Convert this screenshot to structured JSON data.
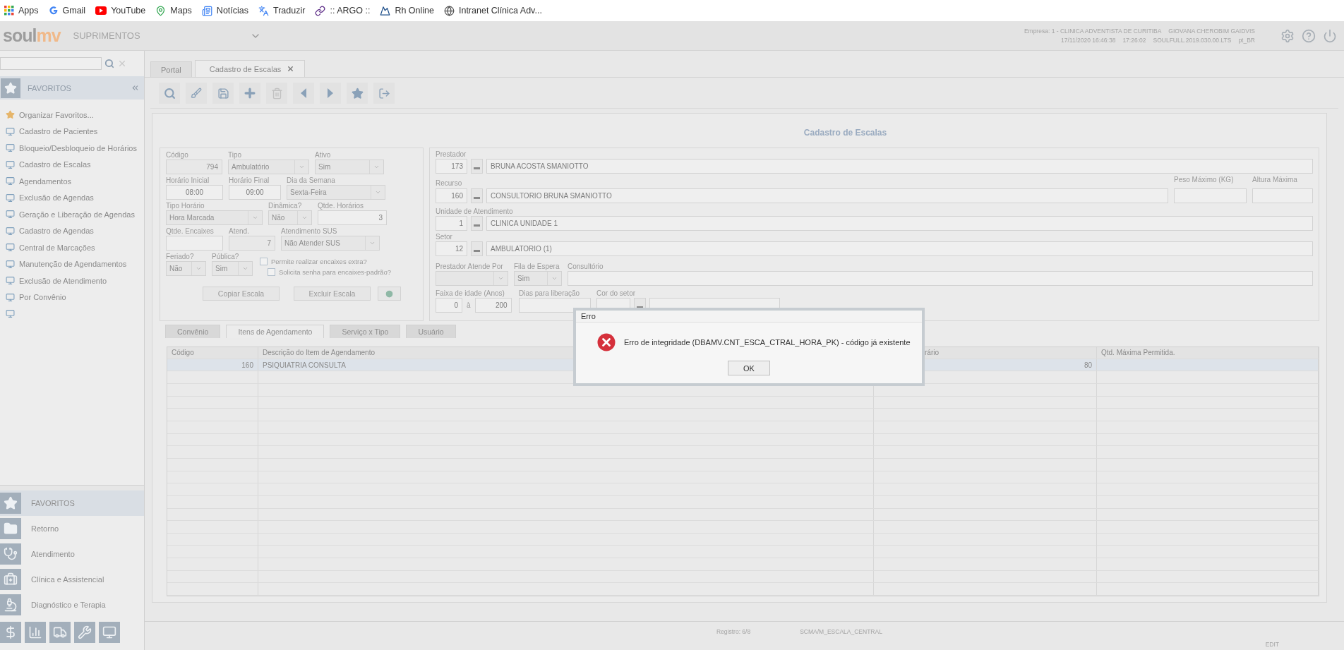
{
  "bookmarks": [
    {
      "label": "Apps",
      "kind": "apps"
    },
    {
      "label": "Gmail",
      "kind": "google"
    },
    {
      "label": "YouTube",
      "kind": "youtube"
    },
    {
      "label": "Maps",
      "kind": "maps"
    },
    {
      "label": "Notícias",
      "kind": "news"
    },
    {
      "label": "Traduzir",
      "kind": "translate"
    },
    {
      "label": ":: ARGO ::",
      "kind": "argo"
    },
    {
      "label": "Rh Online",
      "kind": "rh"
    },
    {
      "label": "Intranet Clínica Adv...",
      "kind": "globe"
    }
  ],
  "header": {
    "logo": {
      "part_1": "soul",
      "part_2": "mv"
    },
    "module": "SUPRIMENTOS",
    "company": "Empresa: 1 - CLINICA ADVENTISTA DE CURITIBA",
    "user": "GIOVANA CHEROBIM GAIDVIS",
    "login_time": "17/11/2020 16:46:38",
    "clock": "17:26:02",
    "version": "SOULFULL.2019.030.00.LTS",
    "locale": "pt_BR"
  },
  "sidebar": {
    "title": "FAVORITOS",
    "items": [
      {
        "label": "Organizar Favoritos...",
        "kind": "star"
      },
      {
        "label": "Cadastro de Pacientes",
        "kind": "screen"
      },
      {
        "label": "Bloqueio/Desbloqueio de Horários",
        "kind": "screen"
      },
      {
        "label": "Cadastro de Escalas",
        "kind": "screen"
      },
      {
        "label": "Agendamentos",
        "kind": "screen"
      },
      {
        "label": "Exclusão de Agendas",
        "kind": "screen"
      },
      {
        "label": "Geração e Liberação de Agendas",
        "kind": "screen"
      },
      {
        "label": "Cadastro de Agendas",
        "kind": "screen"
      },
      {
        "label": "Central de Marcações",
        "kind": "screen"
      },
      {
        "label": "Manutenção de Agendamentos",
        "kind": "screen"
      },
      {
        "label": "Exclusão de Atendimento",
        "kind": "screen"
      },
      {
        "label": "Por Convênio",
        "kind": "screen"
      },
      {
        "kind": "screen"
      }
    ],
    "modules": [
      {
        "label": "FAVORITOS",
        "kind": "star",
        "selected": true
      },
      {
        "label": "Retorno",
        "kind": "folder",
        "selected": false
      },
      {
        "label": "Atendimento",
        "kind": "stethoscope",
        "selected": false
      },
      {
        "label": "Clínica e Assistencial",
        "kind": "medkit",
        "selected": false
      },
      {
        "label": "Diagnóstico e Terapia",
        "kind": "microscope",
        "selected": false
      }
    ],
    "shortcuts": [
      {
        "kind": "dollar"
      },
      {
        "kind": "chart"
      },
      {
        "kind": "truck"
      },
      {
        "kind": "wrench"
      },
      {
        "kind": "screen"
      }
    ]
  },
  "tabs": [
    {
      "label": "Portal",
      "selected": false,
      "closable": false
    },
    {
      "label": "Cadastro de Escalas",
      "selected": true,
      "closable": true
    }
  ],
  "toolbar": [
    {
      "kind": "search",
      "disabled": false
    },
    {
      "kind": "brush",
      "disabled": false
    },
    {
      "kind": "save",
      "disabled": false
    },
    {
      "kind": "add",
      "disabled": false
    },
    {
      "kind": "delete",
      "disabled": true
    },
    {
      "kind": "prev",
      "disabled": false
    },
    {
      "kind": "next",
      "disabled": false
    },
    {
      "kind": "star",
      "disabled": false
    },
    {
      "kind": "exit",
      "disabled": false
    }
  ],
  "form": {
    "title": "Cadastro de Escalas",
    "left": {
      "code": {
        "label": "Código",
        "kind": "text",
        "value": "794",
        "disabled": true
      },
      "type": {
        "label": "Tipo",
        "kind": "select",
        "value": "Ambulatório"
      },
      "active": {
        "label": "Ativo",
        "kind": "select",
        "value": "Sim"
      },
      "start_time": {
        "label": "Horário Inicial",
        "kind": "text",
        "value": "08:00"
      },
      "end_time": {
        "label": "Horário Final",
        "kind": "text",
        "value": "09:00"
      },
      "weekday": {
        "label": "Dia da Semana",
        "kind": "select",
        "value": "Sexta-Feira"
      },
      "schedule_type": {
        "label": "Tipo Horário",
        "kind": "select",
        "value": "Hora Marcada"
      },
      "dynamic": {
        "label": "Dinâmica?",
        "kind": "select",
        "value": "Não"
      },
      "slot_count": {
        "label": "Qtde. Horários",
        "kind": "text",
        "value": "3"
      },
      "extra_count": {
        "label": "Qtde. Encaixes",
        "kind": "text"
      },
      "attended": {
        "label": "Atend.",
        "kind": "text",
        "value": "7",
        "disabled": true
      },
      "sus": {
        "label": "Atendimento SUS",
        "kind": "select",
        "value": "Não Atender SUS"
      },
      "holiday": {
        "label": "Feriado?",
        "kind": "select",
        "value": "Não"
      },
      "public": {
        "label": "Pública?",
        "kind": "select",
        "value": "Sim"
      },
      "checkboxes": [
        {
          "label": "Permite realizar encaixes extra?",
          "checked": false
        },
        {
          "label": "Solicita senha para encaixes-padrão?",
          "checked": false
        }
      ],
      "buttons": [
        "Copiar Escala",
        "Excluir Escala"
      ]
    },
    "right": {
      "provider": {
        "label": "Prestador",
        "code": "173",
        "name": "BRUNA ACOSTA SMANIOTTO"
      },
      "resource": {
        "label": "Recurso",
        "code": "160",
        "name": "CONSULTORIO BRUNA SMANIOTTO"
      },
      "max_weight": {
        "label": "Peso Máximo (KG)"
      },
      "max_height": {
        "label": "Altura Máxima"
      },
      "unit": {
        "label": "Unidade de Atendimento",
        "code": "1",
        "name": "CLINICA UNIDADE 1"
      },
      "sector": {
        "label": "Setor",
        "code": "12",
        "name": "AMBULATORIO (1)"
      },
      "serves_by": {
        "label": "Prestador Atende Por",
        "kind": "select"
      },
      "queue": {
        "label": "Fila de Espera",
        "kind": "select",
        "value": "Sim"
      },
      "office": {
        "label": "Consultório"
      },
      "age_range": {
        "label": "Faixa de idade (Anos)",
        "from": "0",
        "separator": "à",
        "to": "200"
      },
      "release_days": {
        "label": "Dias para liberação"
      },
      "sector_color": {
        "label": "Cor do setor"
      }
    }
  },
  "subtabs": [
    {
      "label": "Convênio",
      "selected": false
    },
    {
      "label": "Itens de Agendamento",
      "selected": true
    },
    {
      "label": "Serviço x Tipo",
      "selected": false
    },
    {
      "label": "Usuário",
      "selected": false
    }
  ],
  "table": {
    "columns": [
      "Código",
      "Descrição do Item de Agendamento",
      "rário",
      "Qtd. Máxima Permitida."
    ],
    "rows": [
      {
        "cells": [
          "160",
          "PSIQUIATRIA CONSULTA",
          "80"
        ],
        "selected": true
      }
    ]
  },
  "status_bar": {
    "record": "Registro: 6/8",
    "screen": "SCMA/M_ESCALA_CENTRAL",
    "mode": "EDIT"
  },
  "dialog": {
    "title": "Erro",
    "kind": "error",
    "message": "Erro de integridade (DBAMV.CNT_ESCA_CTRAL_HORA_PK) - código já existente",
    "button": "OK"
  }
}
